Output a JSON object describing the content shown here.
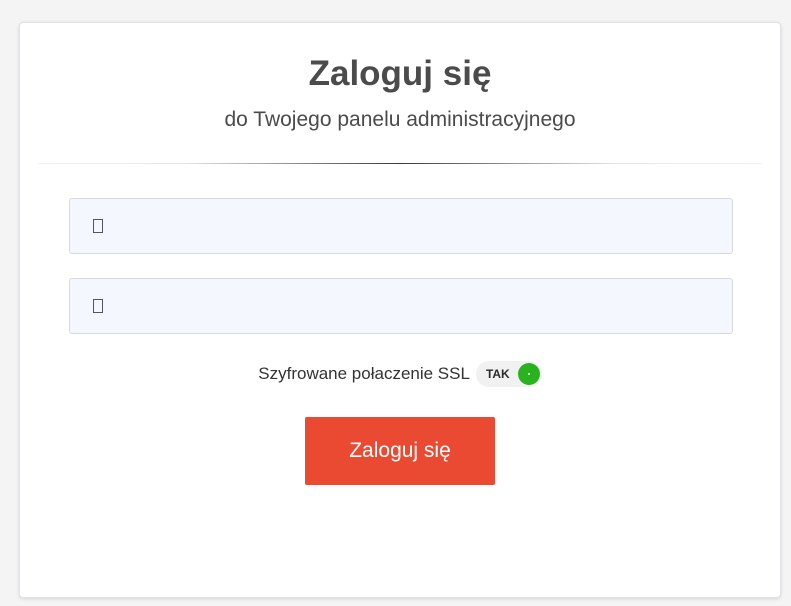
{
  "header": {
    "title": "Zaloguj się",
    "subtitle": "do Twojego panelu administracyjnego"
  },
  "form": {
    "login_field": {
      "value": "",
      "placeholder": "",
      "icon": "user-icon"
    },
    "password_field": {
      "value": "",
      "placeholder": "",
      "icon": "lock-icon"
    },
    "ssl_label": "Szyfrowane połaczenie SSL",
    "ssl_status": "TAK",
    "ssl_status_color": "#2bb31f",
    "submit_label": "Zaloguj się",
    "submit_color": "#ea4a32"
  }
}
